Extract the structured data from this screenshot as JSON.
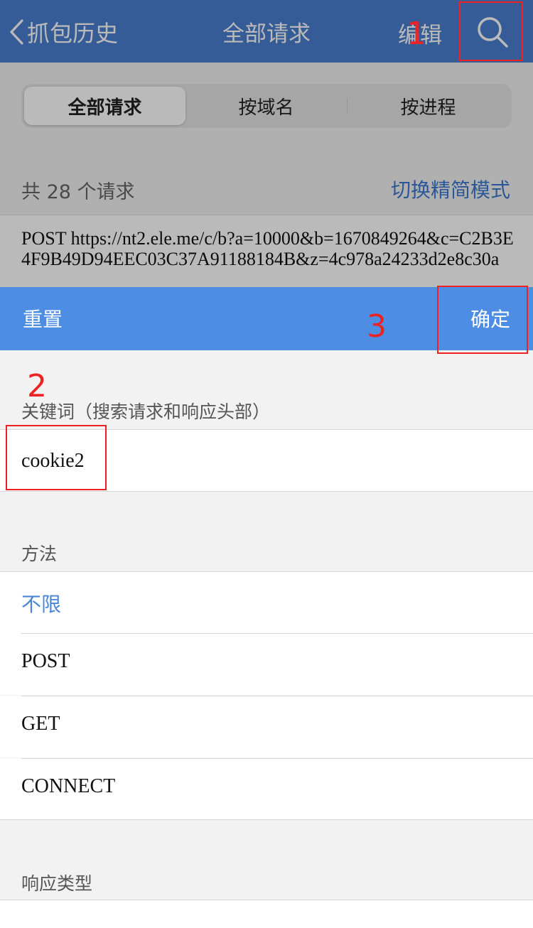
{
  "nav": {
    "back_label": "抓包历史",
    "title": "全部请求",
    "edit_label": "编辑"
  },
  "segments": [
    {
      "label": "全部请求",
      "active": true
    },
    {
      "label": "按域名",
      "active": false
    },
    {
      "label": "按进程",
      "active": false
    }
  ],
  "summary": {
    "count_text": "共 28 个请求",
    "mode_link": "切换精简模式"
  },
  "request_preview": {
    "text": "POST https://nt2.ele.me/c/b?a=10000&b=1670849264&c=C2B3E4F9B49D94EEC03C37A91188184B&z=4c978a24233d2e8c30a"
  },
  "filter": {
    "reset_label": "重置",
    "confirm_label": "确定",
    "keyword_label": "关键词（搜索请求和响应头部）",
    "keyword_value": "cookie2",
    "method_label": "方法",
    "methods": [
      {
        "label": "不限",
        "selected": true
      },
      {
        "label": "POST",
        "selected": false
      },
      {
        "label": "GET",
        "selected": false
      },
      {
        "label": "CONNECT",
        "selected": false
      }
    ],
    "response_type_label": "响应类型"
  },
  "annotations": {
    "step1": "1",
    "step2": "2",
    "step3": "3",
    "color": "#ee2222"
  },
  "colors": {
    "nav_bar": "#4a7fcf",
    "panel_bar": "#4d8ee4",
    "link": "#3b78d0",
    "selected": "#4a86d8"
  }
}
